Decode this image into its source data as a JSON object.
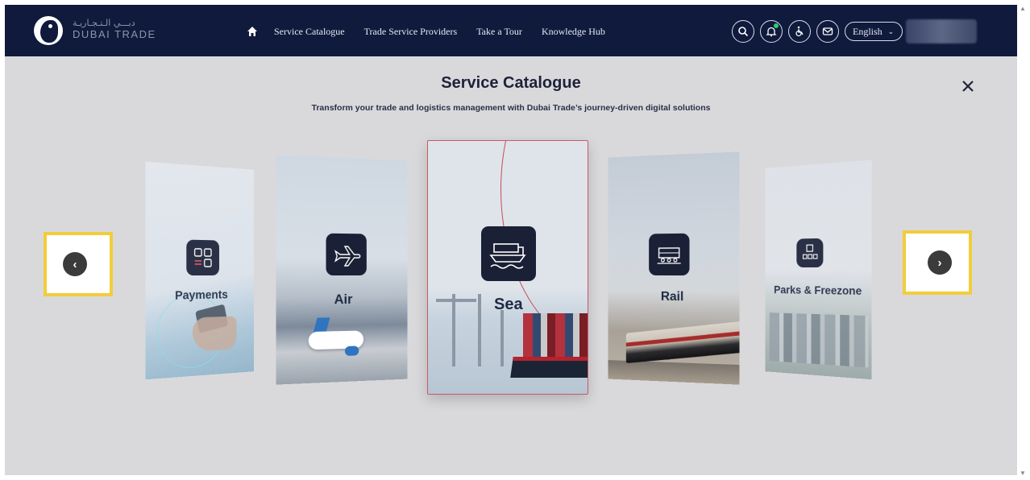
{
  "header": {
    "brand_ar": "دبـــي الـتـجـاريـة",
    "brand_en": "DUBAI TRADE",
    "nav": [
      "Service Catalogue",
      "Trade Service Providers",
      "Take a Tour",
      "Knowledge Hub"
    ],
    "language": "English",
    "icons": {
      "home": "home-icon",
      "search": "search-icon",
      "notifications": "bell-icon",
      "accessibility": "wheelchair-icon",
      "mail": "mail-icon",
      "language_toggle": "chevron-down-icon"
    }
  },
  "modal": {
    "title": "Service Catalogue",
    "subtitle": "Transform your trade and logistics management with Dubai Trade’s journey-driven digital solutions",
    "close_icon": "close-icon"
  },
  "carousel": {
    "prev_glyph": "‹",
    "next_glyph": "›",
    "cards": [
      {
        "label": "Payments",
        "icon": "payments-grid-icon"
      },
      {
        "label": "Air",
        "icon": "airplane-icon"
      },
      {
        "label": "Sea",
        "icon": "ship-icon",
        "active": true
      },
      {
        "label": "Rail",
        "icon": "train-icon"
      },
      {
        "label": "Parks & Freezone",
        "icon": "building-icon"
      }
    ]
  },
  "colors": {
    "header_bg": "#0f1a3c",
    "overlay_bg": "#d9d9dc",
    "highlight": "#f2cd3a",
    "active_border": "#c85a64",
    "icon_tile": "#1a2036"
  }
}
